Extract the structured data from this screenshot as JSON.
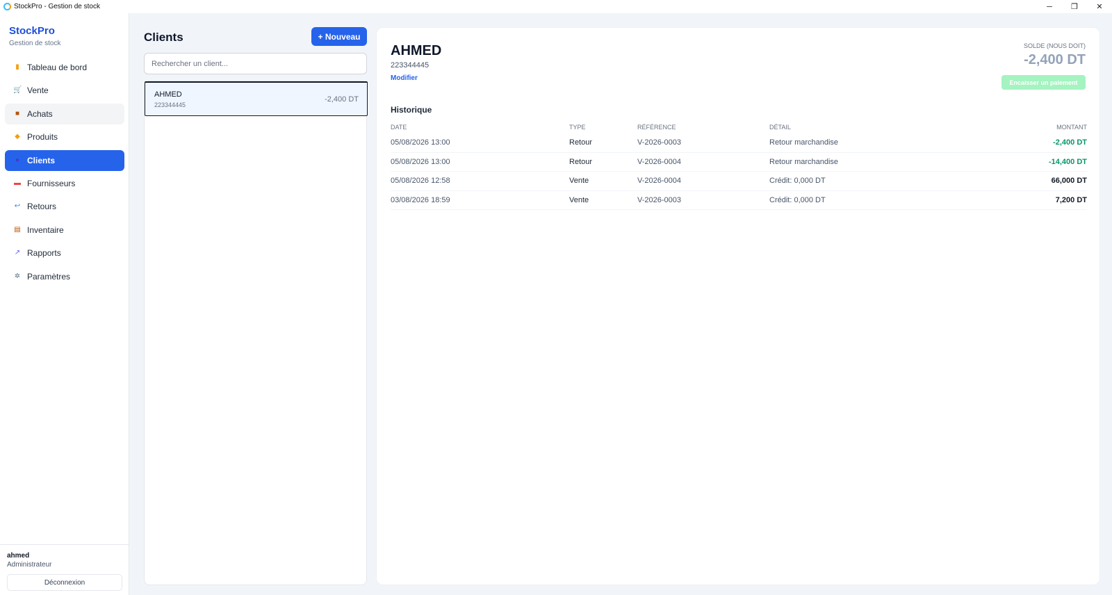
{
  "window": {
    "title": "StockPro - Gestion de stock",
    "controls": [
      "─",
      "❐",
      "✕"
    ]
  },
  "sidebar": {
    "brand": "StockPro",
    "subtitle": "Gestion de stock",
    "items": [
      {
        "label": "Tableau de bord",
        "icon": "dashboard-icon",
        "glyph": "▮",
        "color": "#f59e0b"
      },
      {
        "label": "Vente",
        "icon": "cart-icon",
        "glyph": "🛒",
        "color": "#64748b"
      },
      {
        "label": "Achats",
        "icon": "package-icon",
        "glyph": "■",
        "color": "#b45309"
      },
      {
        "label": "Produits",
        "icon": "tag-icon",
        "glyph": "◆",
        "color": "#f59e0b"
      },
      {
        "label": "Clients",
        "icon": "user-icon",
        "glyph": "●",
        "color": "#4338ca"
      },
      {
        "label": "Fournisseurs",
        "icon": "truck-icon",
        "glyph": "▬",
        "color": "#ef4444"
      },
      {
        "label": "Retours",
        "icon": "return-icon",
        "glyph": "↩",
        "color": "#3b82f6"
      },
      {
        "label": "Inventaire",
        "icon": "clipboard-icon",
        "glyph": "▤",
        "color": "#b45309"
      },
      {
        "label": "Rapports",
        "icon": "chart-icon",
        "glyph": "↗",
        "color": "#6366f1"
      },
      {
        "label": "Paramètres",
        "icon": "gear-icon",
        "glyph": "✲",
        "color": "#64748b"
      }
    ],
    "active_index": 4,
    "hover_index": 2,
    "user": {
      "name": "ahmed",
      "role": "Administrateur"
    },
    "logout_label": "Déconnexion"
  },
  "clients": {
    "title": "Clients",
    "new_label": "+ Nouveau",
    "search_placeholder": "Rechercher un client...",
    "list": [
      {
        "name": "AHMED",
        "phone": "223344445",
        "balance": "-2,400 DT"
      }
    ]
  },
  "detail": {
    "name": "AHMED",
    "phone": "223344445",
    "modify_label": "Modifier",
    "balance_label": "SOLDE (NOUS DOIT)",
    "balance_value": "-2,400 DT",
    "pay_label": "Encaisser un paiement",
    "history_title": "Historique",
    "columns": [
      "DATE",
      "TYPE",
      "RÉFÉRENCE",
      "DÉTAIL",
      "MONTANT"
    ],
    "rows": [
      {
        "date": "05/08/2026 13:00",
        "type": "Retour",
        "ref": "V-2026-0003",
        "detail": "Retour marchandise",
        "amount": "-2,400 DT",
        "tone": "neg"
      },
      {
        "date": "05/08/2026 13:00",
        "type": "Retour",
        "ref": "V-2026-0004",
        "detail": "Retour marchandise",
        "amount": "-14,400 DT",
        "tone": "neg"
      },
      {
        "date": "05/08/2026 12:58",
        "type": "Vente",
        "ref": "V-2026-0004",
        "detail": "Crédit: 0,000 DT",
        "amount": "66,000 DT",
        "tone": "pos"
      },
      {
        "date": "03/08/2026 18:59",
        "type": "Vente",
        "ref": "V-2026-0003",
        "detail": "Crédit: 0,000 DT",
        "amount": "7,200 DT",
        "tone": "pos"
      }
    ]
  }
}
